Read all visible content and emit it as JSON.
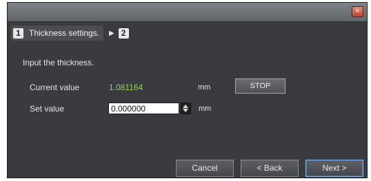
{
  "titlebar": {
    "close_glyph": "×"
  },
  "steps": [
    {
      "num": "1",
      "label": "Thickness settings."
    },
    {
      "num": "2"
    }
  ],
  "step_arrow": "▶",
  "prompt": "Input the thickness.",
  "current": {
    "label": "Current value",
    "value": "1.081164",
    "unit": "mm",
    "stop_label": "STOP"
  },
  "set": {
    "label": "Set value",
    "value": "0.000000",
    "unit": "mm"
  },
  "footer": {
    "cancel": "Cancel",
    "back": "< Back",
    "next": "Next >"
  },
  "colors": {
    "current_value": "#8fd35a",
    "window_bg": "#3a3b3e"
  }
}
